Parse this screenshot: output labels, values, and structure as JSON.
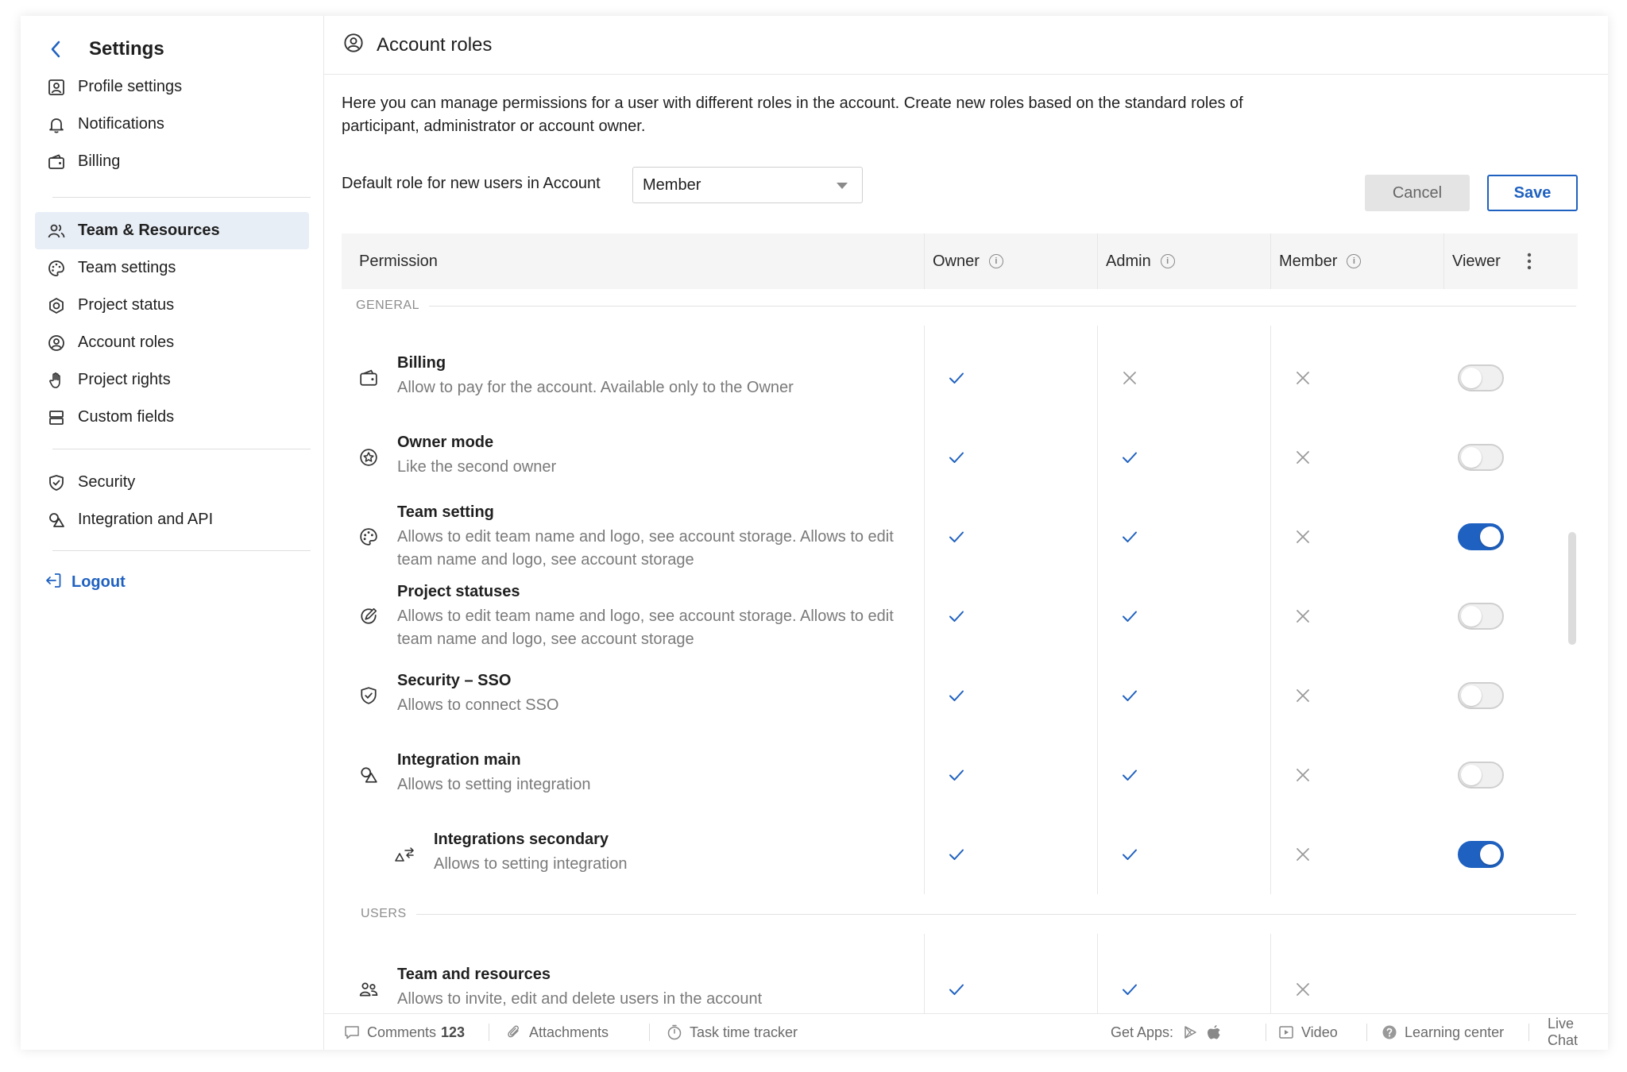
{
  "sidebar": {
    "title": "Settings",
    "items": [
      {
        "label": "Profile settings",
        "icon": "profile-icon"
      },
      {
        "label": "Notifications",
        "icon": "bell-icon"
      },
      {
        "label": "Billing",
        "icon": "wallet-icon"
      },
      {
        "label": "Team & Resources",
        "icon": "team-icon",
        "active": true
      },
      {
        "label": "Team settings",
        "icon": "palette-icon"
      },
      {
        "label": "Project status",
        "icon": "hexagon-icon"
      },
      {
        "label": "Account roles",
        "icon": "user-circle-icon"
      },
      {
        "label": "Project rights",
        "icon": "hand-icon"
      },
      {
        "label": "Custom fields",
        "icon": "fields-icon"
      },
      {
        "label": "Security",
        "icon": "shield-icon"
      },
      {
        "label": "Integration and API",
        "icon": "shapes-icon"
      }
    ],
    "logout": "Logout"
  },
  "header": {
    "title": "Account roles"
  },
  "intro": "Here you can manage permissions for a user with different roles in the account. Create new roles based on the standard roles of participant, administrator or account owner.",
  "default_role": {
    "label": "Default role for new users in Account",
    "value": "Member"
  },
  "buttons": {
    "cancel": "Cancel",
    "save": "Save"
  },
  "table": {
    "columns": [
      "Permission",
      "Owner",
      "Admin",
      "Member",
      "Viewer"
    ],
    "sections": [
      {
        "name": "GENERAL",
        "rows": [
          {
            "title": "Billing",
            "desc": "Allow to pay for the account. Available only to the Owner",
            "icon": "wallet-icon",
            "owner": true,
            "admin": false,
            "member": false,
            "viewer": false
          },
          {
            "title": "Owner mode",
            "desc": "Like the second owner",
            "icon": "star-circle-icon",
            "owner": true,
            "admin": true,
            "member": false,
            "viewer": false
          },
          {
            "title": "Team setting",
            "desc": "Allows to edit team name and logo, see account storage. Allows to edit team name and logo, see account storage",
            "icon": "palette-icon",
            "owner": true,
            "admin": true,
            "member": false,
            "viewer": true
          },
          {
            "title": "Project statuses",
            "desc": "Allows to edit team name and logo, see account storage. Allows to edit team name and logo, see account storage",
            "icon": "status-icon",
            "owner": true,
            "admin": true,
            "member": false,
            "viewer": false
          },
          {
            "title": "Security – SSO",
            "desc": "Allows to connect SSO",
            "icon": "shield-icon",
            "owner": true,
            "admin": true,
            "member": false,
            "viewer": false
          },
          {
            "title": "Integration main",
            "desc": "Allows to setting integration",
            "icon": "shapes-icon",
            "owner": true,
            "admin": true,
            "member": false,
            "viewer": false
          },
          {
            "title": "Integrations secondary",
            "desc": "Allows to setting integration",
            "icon": "transfer-icon",
            "owner": true,
            "admin": true,
            "member": false,
            "viewer": true
          }
        ]
      },
      {
        "name": "USERS",
        "rows": [
          {
            "title": "Team and resources",
            "desc": "Allows to invite, edit and delete users in the account",
            "icon": "users-icon",
            "owner": true,
            "admin": true,
            "member": false
          }
        ]
      }
    ]
  },
  "footer": {
    "comments": "Comments",
    "comments_count": "123",
    "attachments": "Attachments",
    "tracker": "Task time tracker",
    "get_apps": "Get Apps:",
    "video": "Video",
    "learning": "Learning center",
    "chat": "Live Chat"
  },
  "colors": {
    "accent": "#1f61c0",
    "active_bg": "#e8eef6",
    "header_bg": "#f5f5f5"
  }
}
